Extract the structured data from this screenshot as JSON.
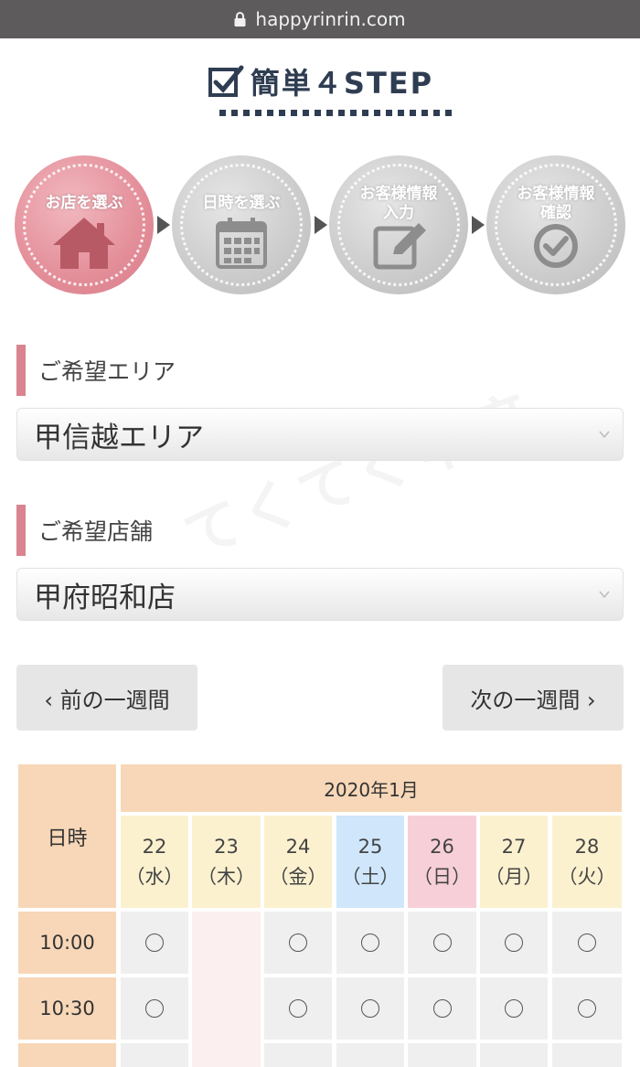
{
  "browser": {
    "url": "happyrinrin.com"
  },
  "steps": {
    "title": "簡単４STEP",
    "items": [
      {
        "label": "お店を選ぶ",
        "state": "active"
      },
      {
        "label": "日時を選ぶ",
        "state": "inactive"
      },
      {
        "label_line1": "お客様情報",
        "label_line2": "入力",
        "state": "inactive"
      },
      {
        "label_line1": "お客様情報",
        "label_line2": "確認",
        "state": "inactive"
      }
    ]
  },
  "area": {
    "label": "ご希望エリア",
    "value": "甲信越エリア"
  },
  "store": {
    "label": "ご希望店舗",
    "value": "甲府昭和店"
  },
  "watermark": "てくてく甲府",
  "week_nav": {
    "prev": "‹ 前の一週間",
    "next": "次の一週間 ›"
  },
  "calendar": {
    "time_header": "日時",
    "month": "2020年1月",
    "days": [
      {
        "date": "22",
        "weekday": "（水）",
        "type": "weekday"
      },
      {
        "date": "23",
        "weekday": "（木）",
        "type": "weekday"
      },
      {
        "date": "24",
        "weekday": "（金）",
        "type": "weekday"
      },
      {
        "date": "25",
        "weekday": "（土）",
        "type": "sat"
      },
      {
        "date": "26",
        "weekday": "（日）",
        "type": "sun"
      },
      {
        "date": "27",
        "weekday": "（月）",
        "type": "weekday"
      },
      {
        "date": "28",
        "weekday": "（火）",
        "type": "weekday"
      }
    ],
    "rows": [
      {
        "time": "10:00",
        "slots": [
          "○",
          "closed",
          "○",
          "○",
          "○",
          "○",
          "○"
        ]
      },
      {
        "time": "10:30",
        "slots": [
          "○",
          "closed",
          "○",
          "○",
          "○",
          "○",
          "○"
        ]
      },
      {
        "time": "",
        "slots": [
          "○",
          "closed",
          "○",
          "○",
          "○",
          "○",
          "○"
        ]
      }
    ]
  },
  "colors": {
    "accent": "#d9848f",
    "navy": "#2f3d52",
    "cal_header": "#f7d7b7",
    "saturday": "#cfe6fb",
    "sunday": "#f7cfd9"
  }
}
